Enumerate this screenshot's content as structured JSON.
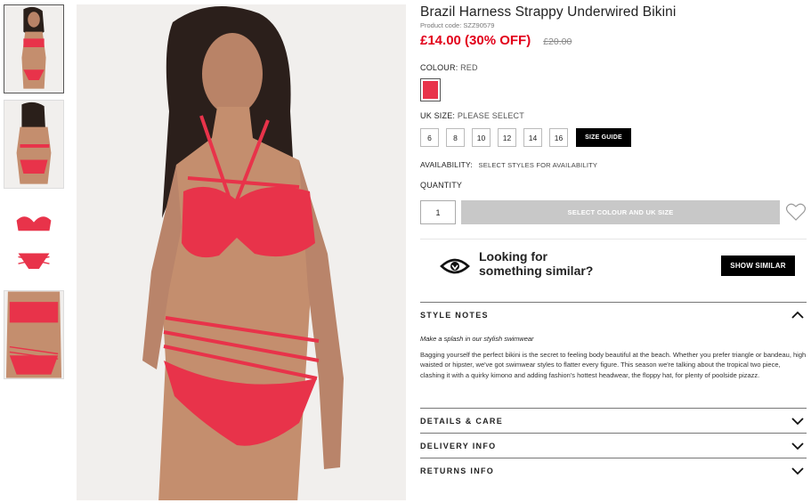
{
  "product": {
    "title": "Brazil Harness Strappy Underwired Bikini",
    "code": "Product code: SZZ90579",
    "price_now": "£14.00 (30% OFF)",
    "price_was": "£20.00"
  },
  "colour": {
    "label": "COLOUR:",
    "value": "RED",
    "swatch_color": "#e8334a"
  },
  "size": {
    "label": "UK SIZE:",
    "value": "PLEASE SELECT",
    "options": [
      "6",
      "8",
      "10",
      "12",
      "14",
      "16"
    ],
    "guide_label": "SIZE GUIDE"
  },
  "availability": {
    "label": "AVAILABILITY:",
    "value": "SELECT STYLES FOR AVAILABILITY"
  },
  "quantity": {
    "label": "QUANTITY",
    "value": "1"
  },
  "add_button": "SELECT COLOUR AND UK SIZE",
  "similar": {
    "text_line1": "Looking for",
    "text_line2": "something similar?",
    "button": "SHOW SIMILAR"
  },
  "accordion": {
    "style_notes": {
      "title": "STYLE NOTES",
      "subtitle": "Make a splash in our stylish swimwear",
      "body": "Bagging yourself the perfect bikini is the secret to feeling body beautiful at the beach. Whether you prefer triangle or bandeau, high waisted or hipster, we've got swimwear styles to flatter every figure. This season we're talking about the tropical two piece, clashing it with a quirky kimono and adding fashion's hottest headwear, the floppy hat, for plenty of poolside pizazz."
    },
    "details": {
      "title": "DETAILS & CARE"
    },
    "delivery": {
      "title": "DELIVERY INFO"
    },
    "returns": {
      "title": "RETURNS INFO"
    }
  },
  "colors": {
    "price_red": "#e2001a",
    "bikini_red": "#e8334a",
    "disabled_button": "#c8c8c8"
  },
  "icons": {
    "eye": "eye-icon",
    "wishlist": "heart-outline-icon",
    "chevron_up": "chevron-up-icon",
    "chevron_down": "chevron-down-icon"
  }
}
